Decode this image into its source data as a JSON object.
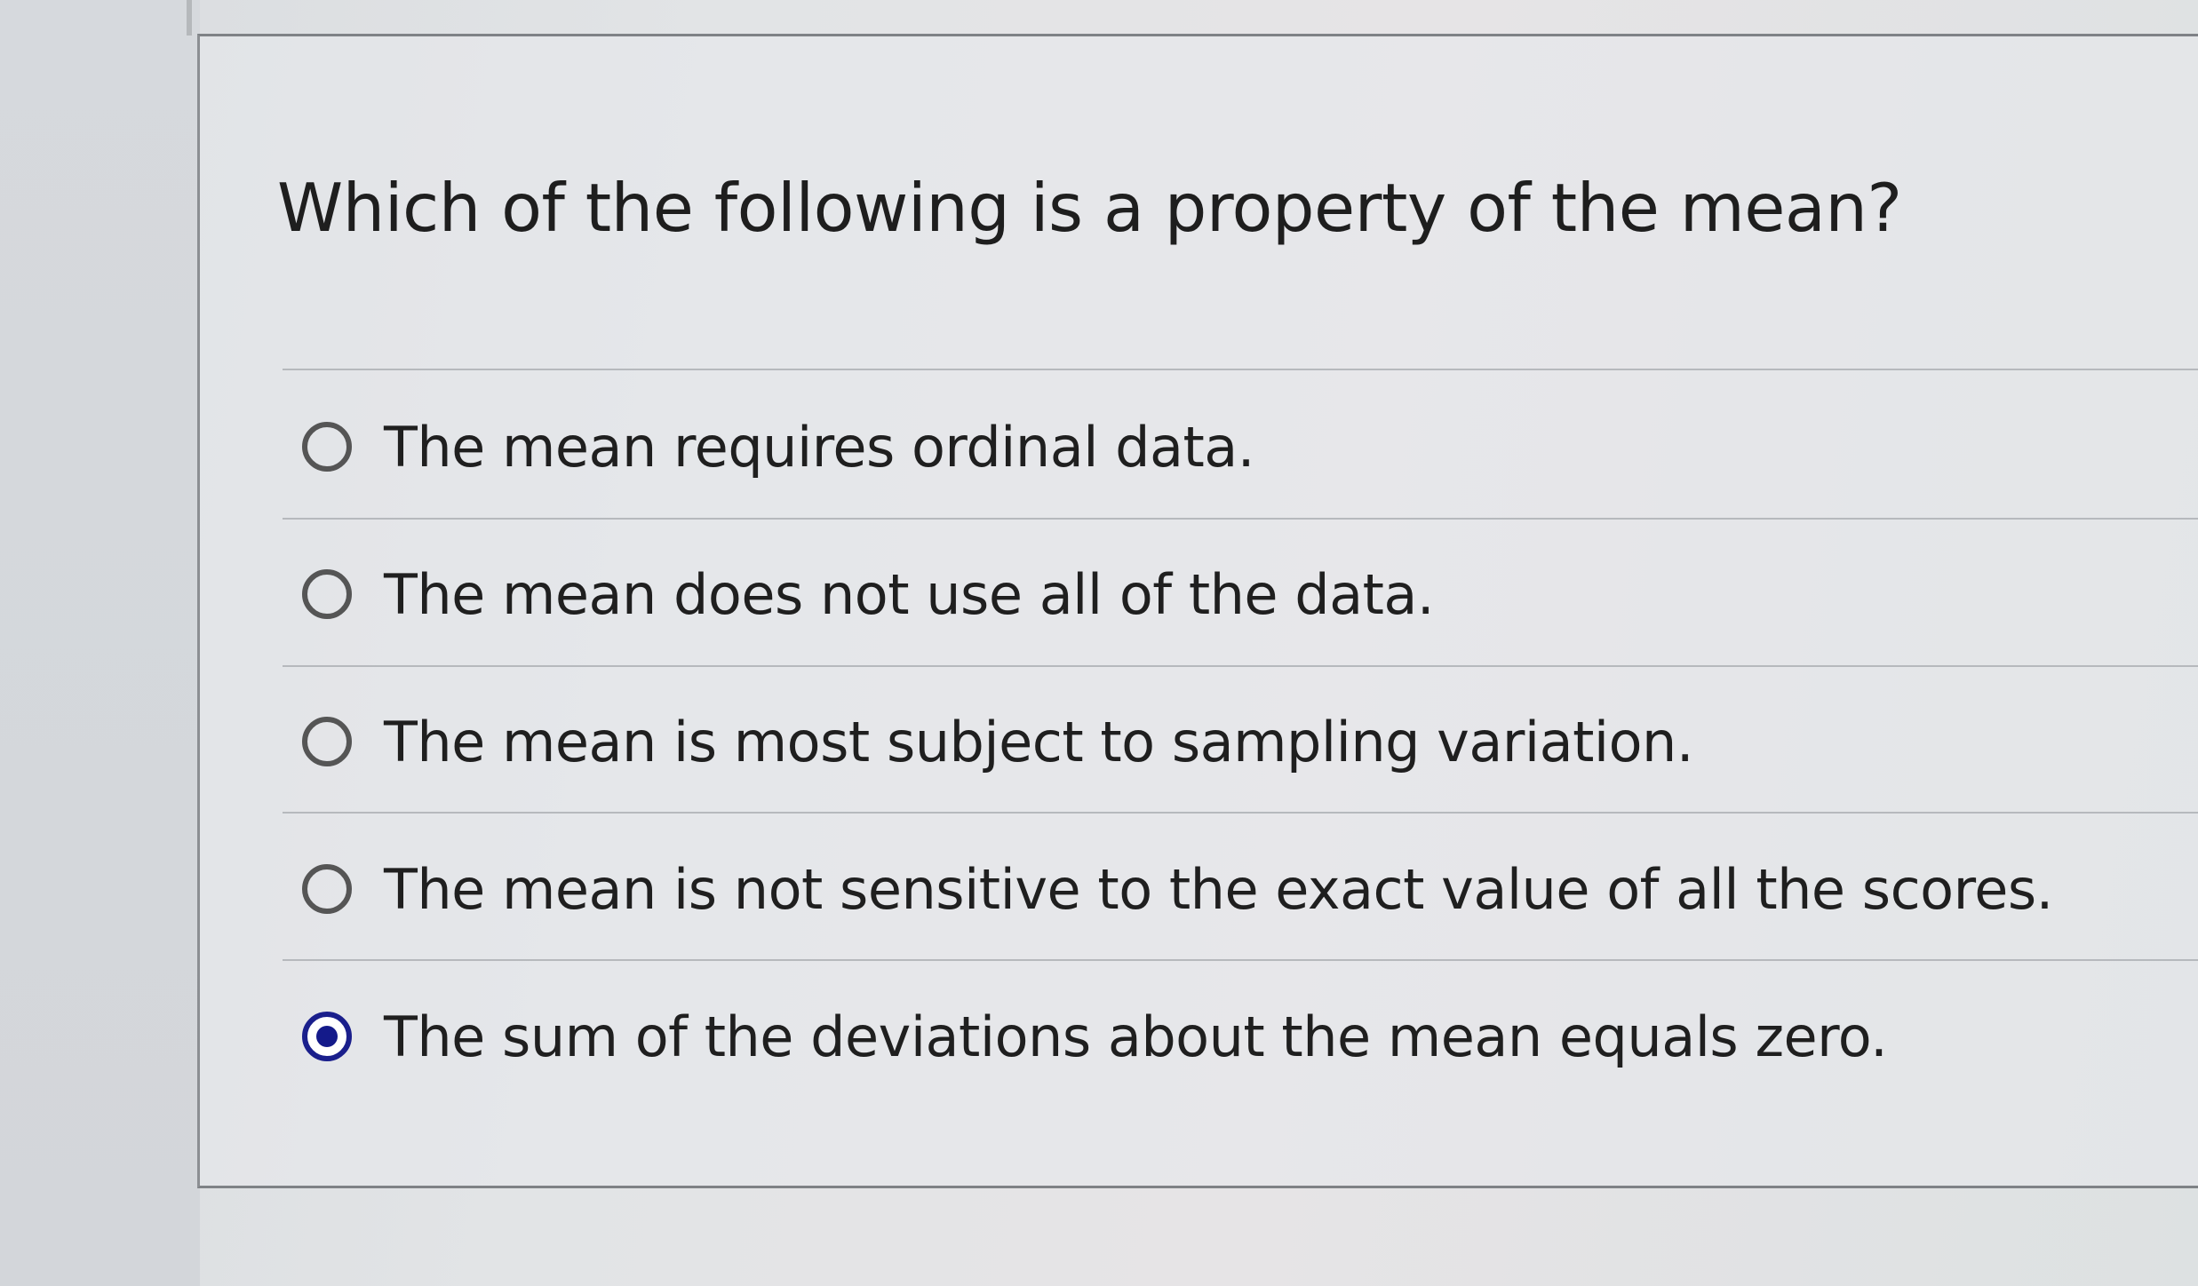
{
  "question": {
    "text": "Which of the following is a property of the mean?"
  },
  "options": [
    {
      "label": "The mean requires ordinal data.",
      "selected": false
    },
    {
      "label": "The mean does not use all of the data.",
      "selected": false
    },
    {
      "label": "The mean is most subject to sampling variation.",
      "selected": false
    },
    {
      "label": "The mean is not sensitive to the exact value of all the scores.",
      "selected": false
    },
    {
      "label": "The sum of the deviations about the mean equals zero.",
      "selected": true
    }
  ],
  "colors": {
    "radio_selected": "#141a8a",
    "radio_unselected": "#555555",
    "text": "#1f1f1f"
  }
}
